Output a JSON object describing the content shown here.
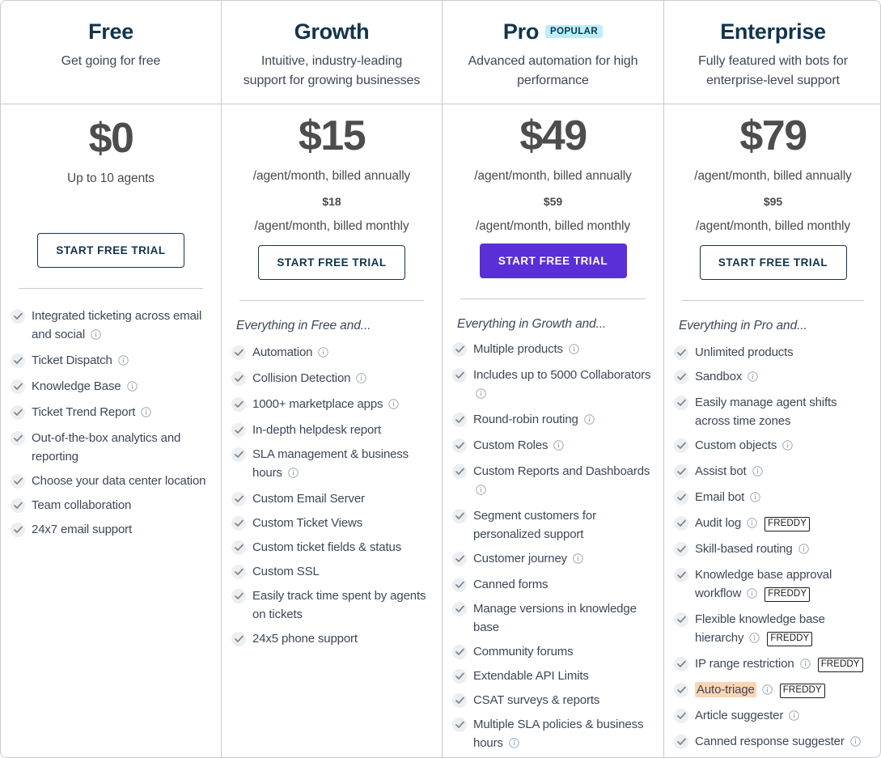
{
  "colors": {
    "accent_primary": "#5a2fd8",
    "badge_popular_bg": "#bbeefa",
    "highlight_bg": "#fcd5b4",
    "check_circle_bg": "#eceef0",
    "divider": "#c9c9cf",
    "price_text": "#4d4d4d",
    "body_text": "#3c4858"
  },
  "plans": [
    {
      "name": "Free",
      "badge": null,
      "tagline": "Get going for free",
      "price": "$0",
      "price_sub": "Up to 10 agents",
      "price_alt": null,
      "price_alt_sub": null,
      "cta_label": "START FREE TRIAL",
      "cta_style": "outline",
      "everything_line": "",
      "features": [
        {
          "text": "Integrated ticketing across email and social",
          "info": true,
          "freddy": false,
          "highlight": false
        },
        {
          "text": "Ticket Dispatch",
          "info": true,
          "freddy": false,
          "highlight": false
        },
        {
          "text": "Knowledge Base",
          "info": true,
          "freddy": false,
          "highlight": false
        },
        {
          "text": "Ticket Trend Report",
          "info": true,
          "freddy": false,
          "highlight": false
        },
        {
          "text": "Out-of-the-box analytics and reporting",
          "info": false,
          "freddy": false,
          "highlight": false
        },
        {
          "text": "Choose your data center location",
          "info": false,
          "freddy": false,
          "highlight": false
        },
        {
          "text": "Team collaboration",
          "info": false,
          "freddy": false,
          "highlight": false
        },
        {
          "text": "24x7 email support",
          "info": false,
          "freddy": false,
          "highlight": false
        }
      ]
    },
    {
      "name": "Growth",
      "badge": null,
      "tagline": "Intuitive, industry-leading support for growing businesses",
      "price": "$15",
      "price_sub": "/agent/month, billed annually",
      "price_alt": "$18",
      "price_alt_sub": "/agent/month, billed monthly",
      "cta_label": "START FREE TRIAL",
      "cta_style": "outline",
      "everything_line": "Everything in Free and...",
      "features": [
        {
          "text": "Automation",
          "info": true,
          "freddy": false,
          "highlight": false
        },
        {
          "text": "Collision Detection",
          "info": true,
          "freddy": false,
          "highlight": false
        },
        {
          "text": "1000+ marketplace apps",
          "info": true,
          "freddy": false,
          "highlight": false
        },
        {
          "text": "In-depth helpdesk report",
          "info": false,
          "freddy": false,
          "highlight": false
        },
        {
          "text": "SLA management & business hours",
          "info": true,
          "freddy": false,
          "highlight": false
        },
        {
          "text": "Custom Email Server",
          "info": false,
          "freddy": false,
          "highlight": false
        },
        {
          "text": "Custom Ticket Views",
          "info": false,
          "freddy": false,
          "highlight": false
        },
        {
          "text": "Custom ticket fields & status",
          "info": false,
          "freddy": false,
          "highlight": false
        },
        {
          "text": "Custom SSL",
          "info": false,
          "freddy": false,
          "highlight": false
        },
        {
          "text": "Easily track time spent by agents on tickets",
          "info": false,
          "freddy": false,
          "highlight": false
        },
        {
          "text": "24x5 phone support",
          "info": false,
          "freddy": false,
          "highlight": false
        }
      ]
    },
    {
      "name": "Pro",
      "badge": "POPULAR",
      "tagline": "Advanced automation for high performance",
      "price": "$49",
      "price_sub": "/agent/month, billed annually",
      "price_alt": "$59",
      "price_alt_sub": "/agent/month, billed monthly",
      "cta_label": "START FREE TRIAL",
      "cta_style": "primary",
      "everything_line": "Everything in Growth and...",
      "features": [
        {
          "text": "Multiple products",
          "info": true,
          "freddy": false,
          "highlight": false
        },
        {
          "text": "Includes up to 5000 Collaborators",
          "info": true,
          "freddy": false,
          "highlight": false
        },
        {
          "text": "Round-robin routing",
          "info": true,
          "freddy": false,
          "highlight": false
        },
        {
          "text": "Custom Roles",
          "info": true,
          "freddy": false,
          "highlight": false
        },
        {
          "text": "Custom Reports and Dashboards",
          "info": true,
          "freddy": false,
          "highlight": false
        },
        {
          "text": "Segment customers for personalized support",
          "info": false,
          "freddy": false,
          "highlight": false
        },
        {
          "text": "Customer journey",
          "info": true,
          "freddy": false,
          "highlight": false
        },
        {
          "text": "Canned forms",
          "info": false,
          "freddy": false,
          "highlight": false
        },
        {
          "text": "Manage versions in knowledge base",
          "info": false,
          "freddy": false,
          "highlight": false
        },
        {
          "text": "Community forums",
          "info": false,
          "freddy": false,
          "highlight": false
        },
        {
          "text": "Extendable API Limits",
          "info": false,
          "freddy": false,
          "highlight": false
        },
        {
          "text": "CSAT surveys & reports",
          "info": false,
          "freddy": false,
          "highlight": false
        },
        {
          "text": "Multiple SLA policies & business hours",
          "info": true,
          "freddy": false,
          "highlight": false
        }
      ]
    },
    {
      "name": "Enterprise",
      "badge": null,
      "tagline": "Fully featured with bots for enterprise-level support",
      "price": "$79",
      "price_sub": "/agent/month, billed annually",
      "price_alt": "$95",
      "price_alt_sub": "/agent/month, billed monthly",
      "cta_label": "START FREE TRIAL",
      "cta_style": "outline",
      "everything_line": "Everything in Pro and...",
      "features": [
        {
          "text": "Unlimited products",
          "info": false,
          "freddy": false,
          "highlight": false
        },
        {
          "text": "Sandbox",
          "info": true,
          "freddy": false,
          "highlight": false
        },
        {
          "text": "Easily manage agent shifts across time zones",
          "info": false,
          "freddy": false,
          "highlight": false
        },
        {
          "text": "Custom objects",
          "info": true,
          "freddy": false,
          "highlight": false
        },
        {
          "text": "Assist bot",
          "info": true,
          "freddy": false,
          "highlight": false
        },
        {
          "text": "Email bot",
          "info": true,
          "freddy": false,
          "highlight": false
        },
        {
          "text": "Audit log",
          "info": true,
          "freddy": true,
          "highlight": false
        },
        {
          "text": "Skill-based routing",
          "info": true,
          "freddy": false,
          "highlight": false
        },
        {
          "text": "Knowledge base approval workflow",
          "info": true,
          "freddy": true,
          "highlight": false
        },
        {
          "text": "Flexible knowledge base hierarchy",
          "info": true,
          "freddy": true,
          "highlight": false
        },
        {
          "text": "IP range restriction",
          "info": true,
          "freddy": true,
          "highlight": false
        },
        {
          "text": "Auto-triage",
          "info": true,
          "freddy": true,
          "highlight": true
        },
        {
          "text": "Article suggester",
          "info": true,
          "freddy": false,
          "highlight": false
        },
        {
          "text": "Canned response suggester",
          "info": true,
          "freddy": false,
          "highlight": false
        }
      ]
    }
  ],
  "freddy_badge_label": "FREDDY"
}
